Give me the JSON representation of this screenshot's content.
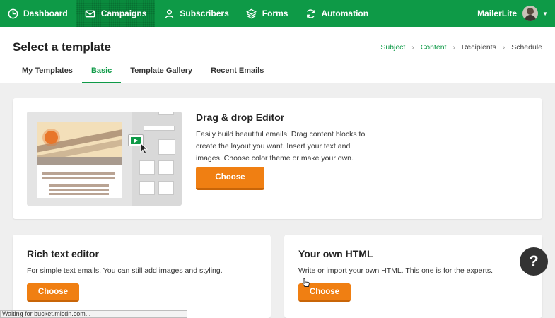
{
  "nav": {
    "items": [
      {
        "label": "Dashboard",
        "icon": "dashboard-icon"
      },
      {
        "label": "Campaigns",
        "icon": "envelope-icon"
      },
      {
        "label": "Subscribers",
        "icon": "user-icon"
      },
      {
        "label": "Forms",
        "icon": "forms-icon"
      },
      {
        "label": "Automation",
        "icon": "automation-icon"
      }
    ],
    "active": "Campaigns",
    "account_name": "MailerLite"
  },
  "header": {
    "title": "Select a template",
    "steps": [
      "Subject",
      "Content",
      "Recipients",
      "Schedule"
    ],
    "completed_steps": [
      "Subject",
      "Content"
    ]
  },
  "tabs": {
    "items": [
      "My Templates",
      "Basic",
      "Template Gallery",
      "Recent Emails"
    ],
    "active": "Basic"
  },
  "cards": {
    "dragdrop": {
      "title": "Drag & drop Editor",
      "description": "Easily build beautiful emails! Drag content blocks to create the layout you want. Insert your text and images. Choose color theme or make your own.",
      "button": "Choose"
    },
    "richtext": {
      "title": "Rich text editor",
      "description": "For simple text emails. You can still add images and styling.",
      "button": "Choose"
    },
    "html": {
      "title": "Your own HTML",
      "description": "Write or import your own HTML. This one is for the experts.",
      "button": "Choose"
    }
  },
  "help": {
    "label": "?"
  },
  "status": {
    "text": "Waiting for bucket.mlcdn.com..."
  },
  "colors": {
    "brand_green": "#0e9a47",
    "button_orange": "#f07f12"
  }
}
